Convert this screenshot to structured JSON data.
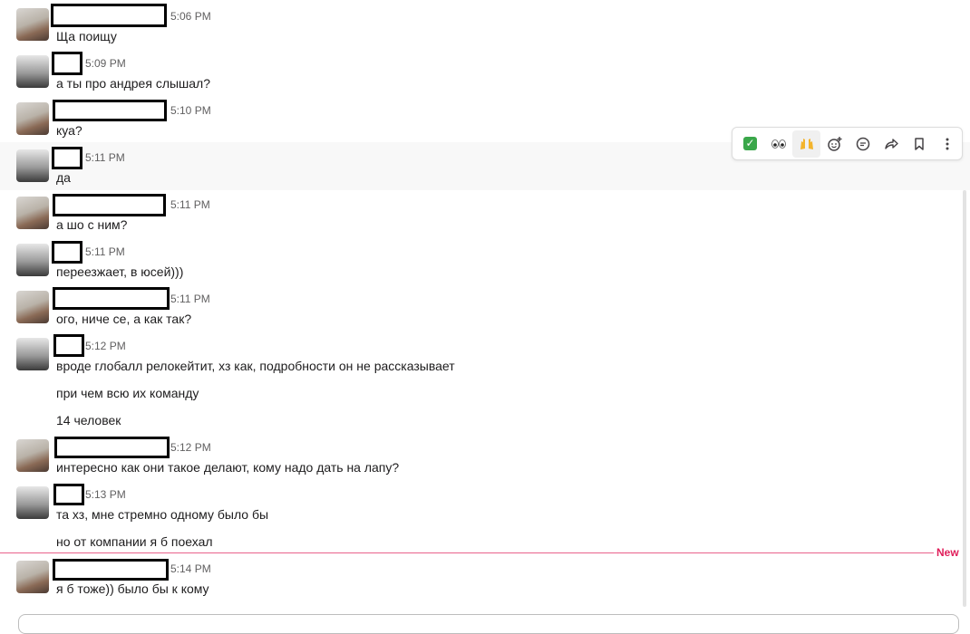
{
  "messages": [
    {
      "time": "5:06 PM",
      "lines": [
        "Ща поищу"
      ]
    },
    {
      "time": "5:09 PM",
      "lines": [
        "а ты про андрея слышал?"
      ]
    },
    {
      "time": "5:10 PM",
      "lines": [
        "куа?"
      ]
    },
    {
      "time": "5:11 PM",
      "lines": [
        "да"
      ]
    },
    {
      "time": "5:11 PM",
      "lines": [
        "а шо с ним?"
      ]
    },
    {
      "time": "5:11 PM",
      "lines": [
        "переезжает, в юсей)))"
      ]
    },
    {
      "time": "5:11 PM",
      "lines": [
        "ого, ниче се, а как так?"
      ]
    },
    {
      "time": "5:12 PM",
      "lines": [
        "вроде глобалл релокейтит, хз как, подробности он не рассказывает",
        "при чем всю их команду",
        "14 человек"
      ]
    },
    {
      "time": "5:12 PM",
      "lines": [
        "интересно как они такое делают, кому надо дать на лапу?"
      ]
    },
    {
      "time": "5:13 PM",
      "lines": [
        "та хз, мне стремно одному было бы",
        "но от компании я б поехал"
      ]
    },
    {
      "time": "5:14 PM",
      "lines": [
        "я б тоже)) было бы к кому"
      ]
    }
  ],
  "divider": {
    "label": "New",
    "color": "#e01e5a"
  },
  "toolbar": {
    "buttons": [
      {
        "name": "check-reaction-icon",
        "glyph": "✅"
      },
      {
        "name": "eyes-reaction-icon",
        "glyph": "👀"
      },
      {
        "name": "raised-hands-reaction-icon",
        "glyph": "🙌"
      },
      {
        "name": "add-reaction-icon",
        "glyph": "☺"
      },
      {
        "name": "reply-thread-icon",
        "glyph": "💬"
      },
      {
        "name": "forward-icon",
        "glyph": "➦"
      },
      {
        "name": "bookmark-icon",
        "glyph": "🔖"
      },
      {
        "name": "more-actions-icon",
        "glyph": "⋮"
      }
    ]
  }
}
